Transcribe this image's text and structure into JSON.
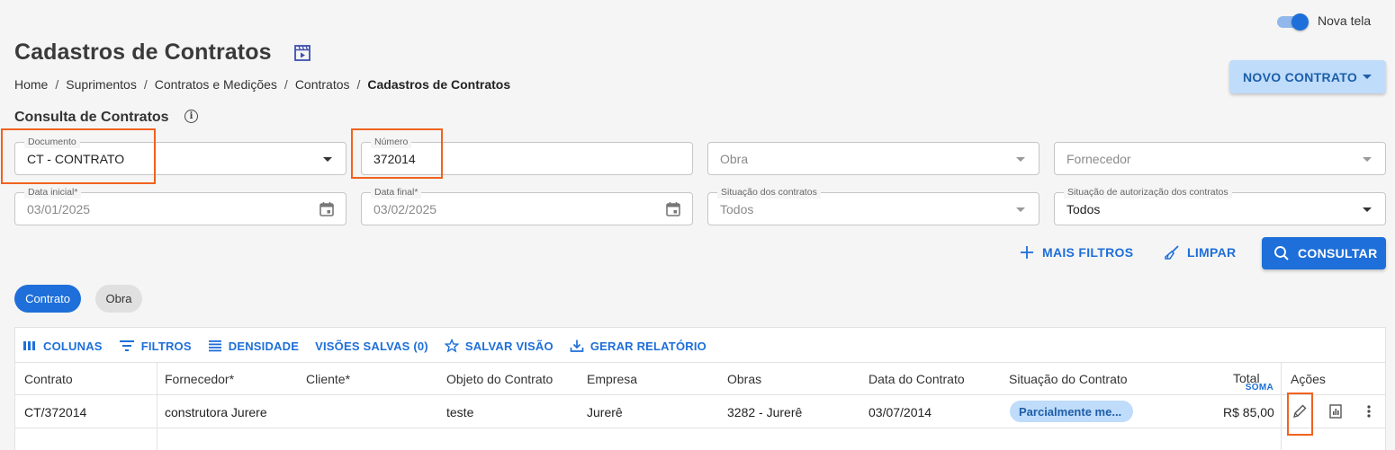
{
  "toggle": {
    "label": "Nova tela",
    "on": true
  },
  "page": {
    "title": "Cadastros de Contratos",
    "title_icon": "video-list-icon"
  },
  "breadcrumb": [
    "Home",
    "Suprimentos",
    "Contratos e Medições",
    "Contratos",
    "Cadastros de Contratos"
  ],
  "new_button": {
    "label": "NOVO CONTRATO"
  },
  "section": {
    "title": "Consulta de Contratos"
  },
  "filters": {
    "documento": {
      "label": "Documento",
      "value": "CT - CONTRATO"
    },
    "numero": {
      "label": "Número",
      "value": "372014"
    },
    "obra": {
      "placeholder": "Obra"
    },
    "fornecedor": {
      "placeholder": "Fornecedor"
    },
    "data_inicial": {
      "label": "Data inicial*",
      "value": "03/01/2025"
    },
    "data_final": {
      "label": "Data final*",
      "value": "03/02/2025"
    },
    "situacao": {
      "label": "Situação dos contratos",
      "value": "Todos"
    },
    "situacao_aut": {
      "label": "Situação de autorização dos contratos",
      "value": "Todos"
    }
  },
  "actions": {
    "mais_filtros": "MAIS FILTROS",
    "limpar": "LIMPAR",
    "consultar": "CONSULTAR"
  },
  "tabs": [
    "Contrato",
    "Obra"
  ],
  "toolbar": {
    "colunas": "COLUNAS",
    "filtros": "FILTROS",
    "densidade": "DENSIDADE",
    "visoes": "VISÕES SALVAS (0)",
    "salvar": "SALVAR VISÃO",
    "relatorio": "GERAR RELATÓRIO"
  },
  "table": {
    "headers": {
      "contrato": "Contrato",
      "fornecedor": "Fornecedor*",
      "cliente": "Cliente*",
      "objeto": "Objeto do Contrato",
      "empresa": "Empresa",
      "obras": "Obras",
      "data": "Data do Contrato",
      "situacao": "Situação do Contrato",
      "total": "Total",
      "soma": "SOMA",
      "acoes": "Ações"
    },
    "rows": [
      {
        "contrato": "CT/372014",
        "fornecedor": "construtora Jurere",
        "cliente": "",
        "objeto": "teste",
        "empresa": "Jurerê",
        "obras": "3282 - Jurerê",
        "data": "03/07/2014",
        "situacao": "Parcialmente me...",
        "total": "R$ 85,00"
      }
    ]
  },
  "colors": {
    "primary": "#1e6fd9",
    "highlight": "#f0621e",
    "badge_bg": "#bfdcfb"
  }
}
